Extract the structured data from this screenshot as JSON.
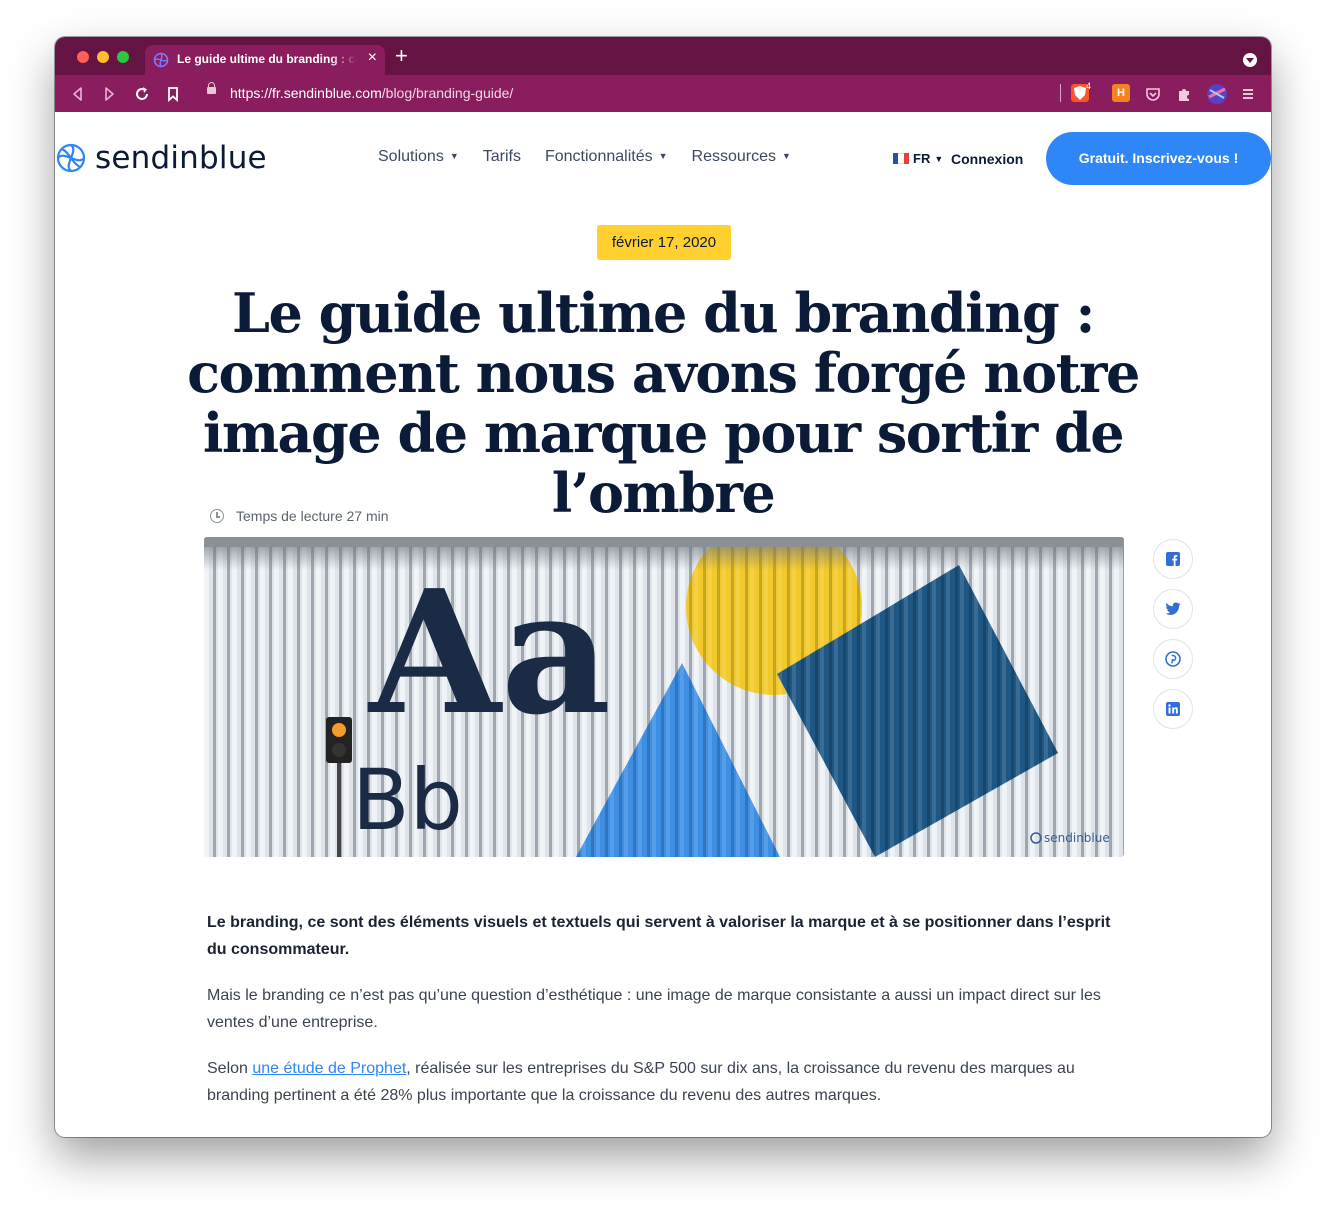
{
  "browser": {
    "tab_title": "Le guide ultime du branding : comment nous avons forgé notre image de marque pour sortir de l’ombre",
    "url_host": "https://fr.sendinblue.com",
    "url_path": "/blog/branding-guide/",
    "shield_count": "4",
    "new_tab_symbol": "+",
    "close_symbol": "×",
    "colors": {
      "tab_strip": "#641342",
      "toolbar": "#8a1d5d"
    }
  },
  "site": {
    "logo_text": "sendinblue",
    "nav": [
      {
        "label": "Solutions",
        "has_dropdown": true
      },
      {
        "label": "Tarifs",
        "has_dropdown": false
      },
      {
        "label": "Fonctionnalités",
        "has_dropdown": true
      },
      {
        "label": "Ressources",
        "has_dropdown": true
      }
    ],
    "language": "FR",
    "login": "Connexion",
    "cta": "Gratuit. Inscrivez-vous !",
    "colors": {
      "brand_blue": "#2f86f6",
      "navy": "#0b1a36",
      "badge_yellow": "#ffd02f"
    }
  },
  "article": {
    "date": "février 17, 2020",
    "title": "Le guide ultime du branding : comment nous avons forgé notre image de marque pour sortir de l’ombre",
    "read_time": "Temps de lecture 27 min",
    "hero": {
      "big_letters": "Aa",
      "small_letters": "Bb",
      "watermark": "sendinblue"
    },
    "share_icons": [
      "facebook-icon",
      "twitter-icon",
      "pinterest-icon",
      "linkedin-icon"
    ],
    "lead": "Le branding, ce sont des éléments visuels et textuels qui servent à valoriser la marque et à se positionner dans l’esprit du consommateur.",
    "p1": "Mais le branding ce n’est pas qu’une question d’esthétique : une image de marque consistante a aussi un impact direct sur les ventes d’une entreprise.",
    "p2_before": "Selon ",
    "p2_link": "une étude de Prophet",
    "p2_after": ", réalisée sur les entreprises du S&P 500 sur dix ans, la croissance du revenu des marques au branding pertinent a été 28% plus importante que la croissance du revenu des autres marques."
  }
}
